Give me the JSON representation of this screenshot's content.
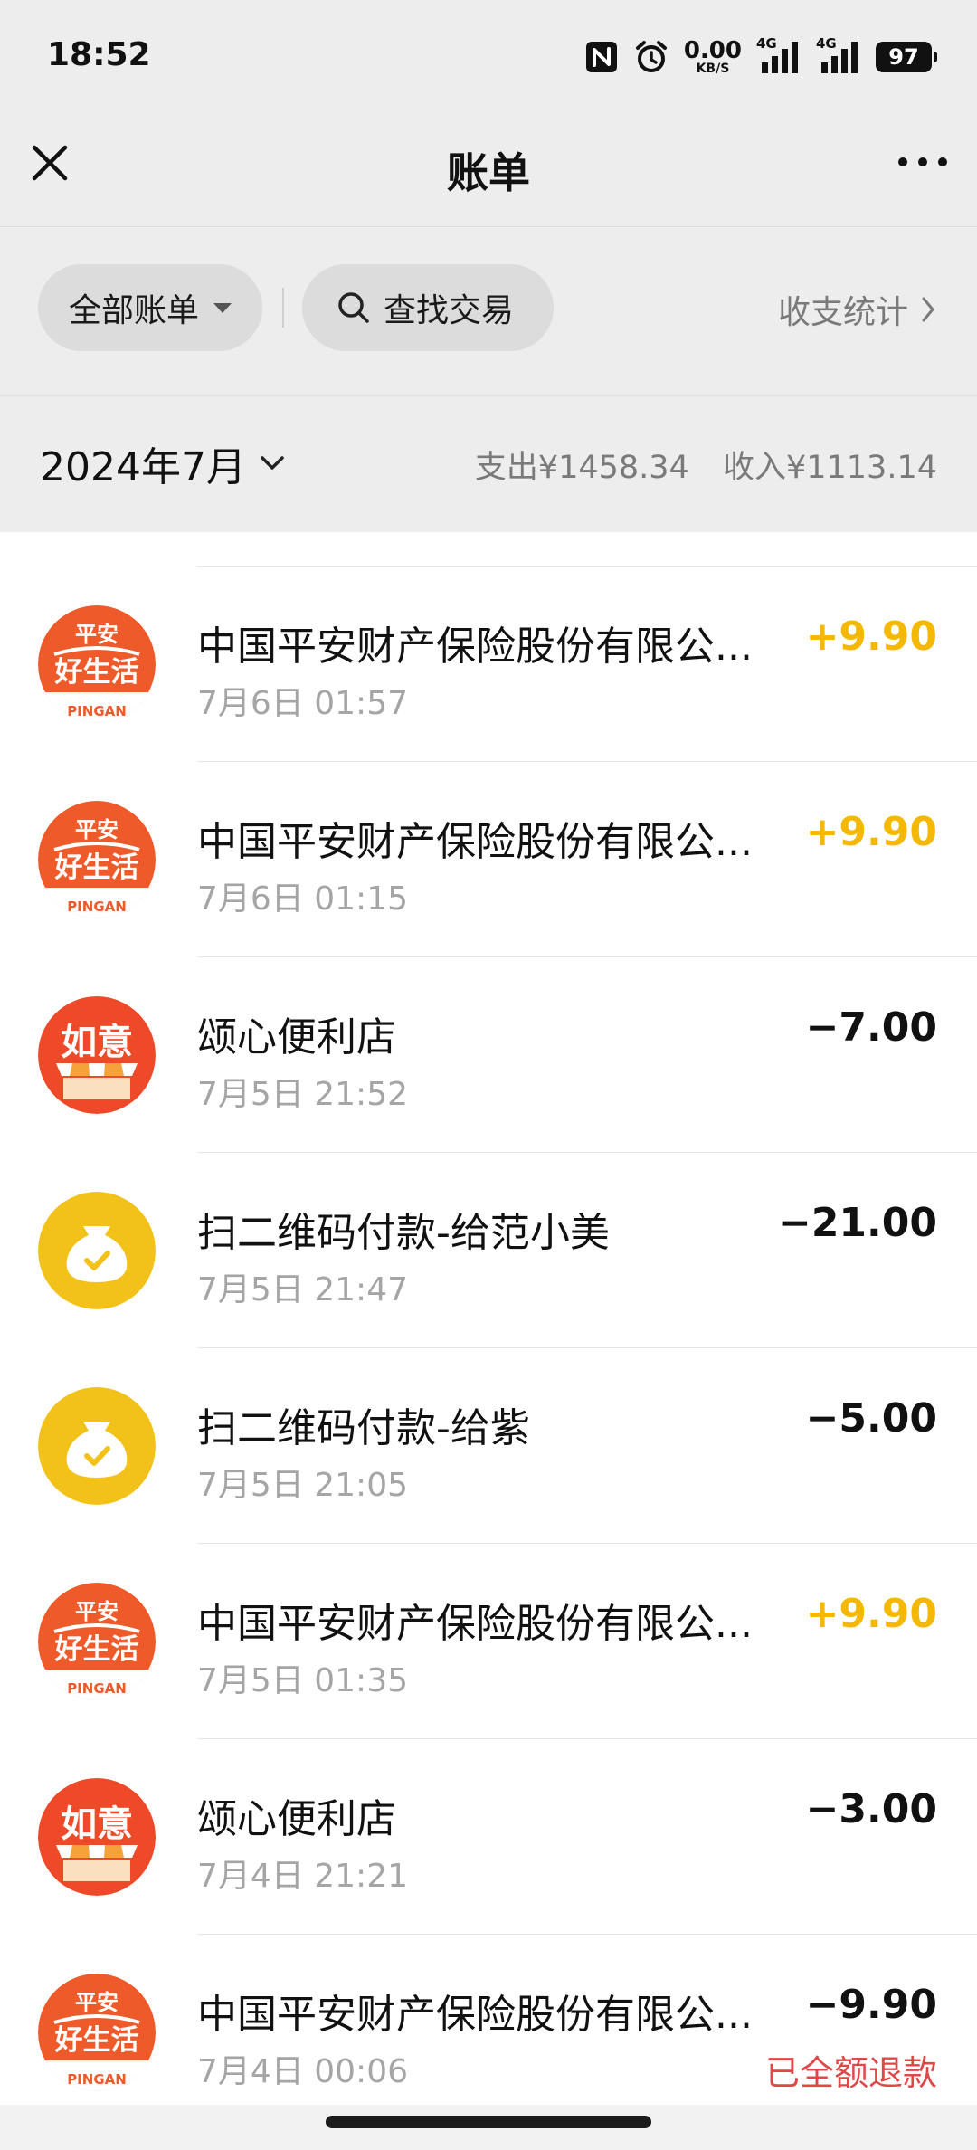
{
  "status_bar": {
    "time": "18:52",
    "net_speed_value": "0.00",
    "net_speed_unit": "KB/S",
    "signal1_label": "4G",
    "signal2_label": "4G",
    "battery": "97",
    "icons": [
      "nfc-icon",
      "alarm-icon",
      "signal-icon",
      "battery-icon"
    ]
  },
  "nav": {
    "title": "账单",
    "close_icon": "close-icon",
    "more_icon": "more-icon"
  },
  "filters": {
    "all_bills": "全部账单",
    "search": "查找交易",
    "stats": "收支统计"
  },
  "month": {
    "label": "2024年7月",
    "expense": "支出¥1458.34",
    "income": "收入¥1113.14"
  },
  "colors": {
    "income": "#f5b800",
    "refund_note": "#e04747",
    "pingan": "#ef5a2b",
    "ruyi": "#ee4a2a",
    "pay": "#f2c21a"
  },
  "transactions": [
    {
      "icon": "pingan",
      "title": "中国平安财产保险股份有限公...",
      "time": "7月6日 01:57",
      "amount": "+9.90",
      "type": "income",
      "note": ""
    },
    {
      "icon": "pingan",
      "title": "中国平安财产保险股份有限公...",
      "time": "7月6日 01:15",
      "amount": "+9.90",
      "type": "income",
      "note": ""
    },
    {
      "icon": "ruyi",
      "title": "颂心便利店",
      "time": "7月5日 21:52",
      "amount": "−7.00",
      "type": "expense",
      "note": ""
    },
    {
      "icon": "pay",
      "title": "扫二维码付款-给范小美",
      "time": "7月5日 21:47",
      "amount": "−21.00",
      "type": "expense",
      "note": ""
    },
    {
      "icon": "pay",
      "title": "扫二维码付款-给紫",
      "time": "7月5日 21:05",
      "amount": "−5.00",
      "type": "expense",
      "note": ""
    },
    {
      "icon": "pingan",
      "title": "中国平安财产保险股份有限公...",
      "time": "7月5日 01:35",
      "amount": "+9.90",
      "type": "income",
      "note": ""
    },
    {
      "icon": "ruyi",
      "title": "颂心便利店",
      "time": "7月4日 21:21",
      "amount": "−3.00",
      "type": "expense",
      "note": ""
    },
    {
      "icon": "pingan",
      "title": "中国平安财产保险股份有限公...",
      "time": "7月4日 00:06",
      "amount": "−9.90",
      "type": "expense",
      "note": "已全额退款"
    }
  ],
  "logo_text": {
    "pingan_top": "平安",
    "pingan_main": "好生活",
    "pingan_brand": "PINGAN",
    "ruyi": "如意"
  }
}
